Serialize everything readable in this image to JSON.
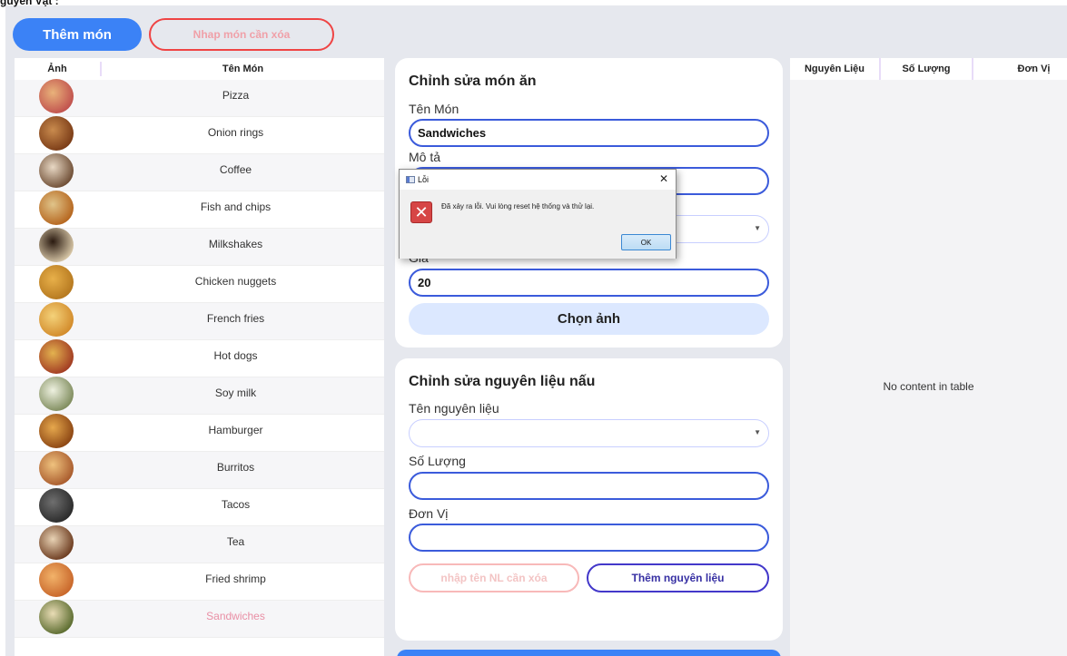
{
  "window": {
    "title_fragment": "guyên Vật :"
  },
  "toolbar": {
    "add_dish_label": "Thêm món",
    "delete_dish_placeholder": "Nhap món cần xóa"
  },
  "dish_table": {
    "headers": {
      "image": "Ảnh",
      "name": "Tên Món"
    },
    "rows": [
      {
        "name": "Pizza",
        "image_icon": "pizza-image"
      },
      {
        "name": "Onion rings",
        "image_icon": "onion-rings-image"
      },
      {
        "name": "Coffee",
        "image_icon": "coffee-image"
      },
      {
        "name": "Fish and chips",
        "image_icon": "fish-and-chips-image"
      },
      {
        "name": "Milkshakes",
        "image_icon": "milkshakes-image"
      },
      {
        "name": "Chicken nuggets",
        "image_icon": "chicken-nuggets-image"
      },
      {
        "name": "French fries",
        "image_icon": "french-fries-image"
      },
      {
        "name": "Hot dogs",
        "image_icon": "hot-dogs-image"
      },
      {
        "name": "Soy milk",
        "image_icon": "soy-milk-image"
      },
      {
        "name": "Hamburger",
        "image_icon": "hamburger-image"
      },
      {
        "name": "Burritos",
        "image_icon": "burritos-image"
      },
      {
        "name": "Tacos",
        "image_icon": "tacos-image"
      },
      {
        "name": "Tea",
        "image_icon": "tea-image"
      },
      {
        "name": "Fried shrimp",
        "image_icon": "fried-shrimp-image"
      },
      {
        "name": "Sandwiches",
        "image_icon": "sandwiches-image"
      }
    ],
    "selected_row": "Sandwiches"
  },
  "edit_dish": {
    "title": "Chỉnh sửa món ăn",
    "name_label": "Tên Món",
    "name_value": "Sandwiches",
    "desc_label": "Mô tả",
    "price_label": "Giá",
    "price_value": "20",
    "choose_image_label": "Chọn ảnh"
  },
  "edit_ingredient": {
    "title": "Chỉnh sửa nguyên liệu nấu",
    "ingredient_label": "Tên nguyên liệu",
    "quantity_label": "Số Lượng",
    "unit_label": "Đơn Vị",
    "delete_placeholder": "nhập tên NL cần xóa",
    "add_label": "Thêm nguyên liệu"
  },
  "ingredient_table": {
    "headers": {
      "ingredient": "Nguyên Liệu",
      "quantity": "Số Lượng",
      "unit": "Đơn Vị"
    },
    "empty_message": "No content in table"
  },
  "error_dialog": {
    "title": "Lỗi",
    "message": "Đã xảy ra lỗi. Vui lòng reset hệ thống và thử lại.",
    "ok_label": "OK",
    "close_glyph": "✕",
    "error_glyph": "✕"
  },
  "colors": {
    "primary": "#3b82f6",
    "danger": "#ef4444",
    "accent_indigo": "#4338ca",
    "background": "#e6e8ee"
  }
}
